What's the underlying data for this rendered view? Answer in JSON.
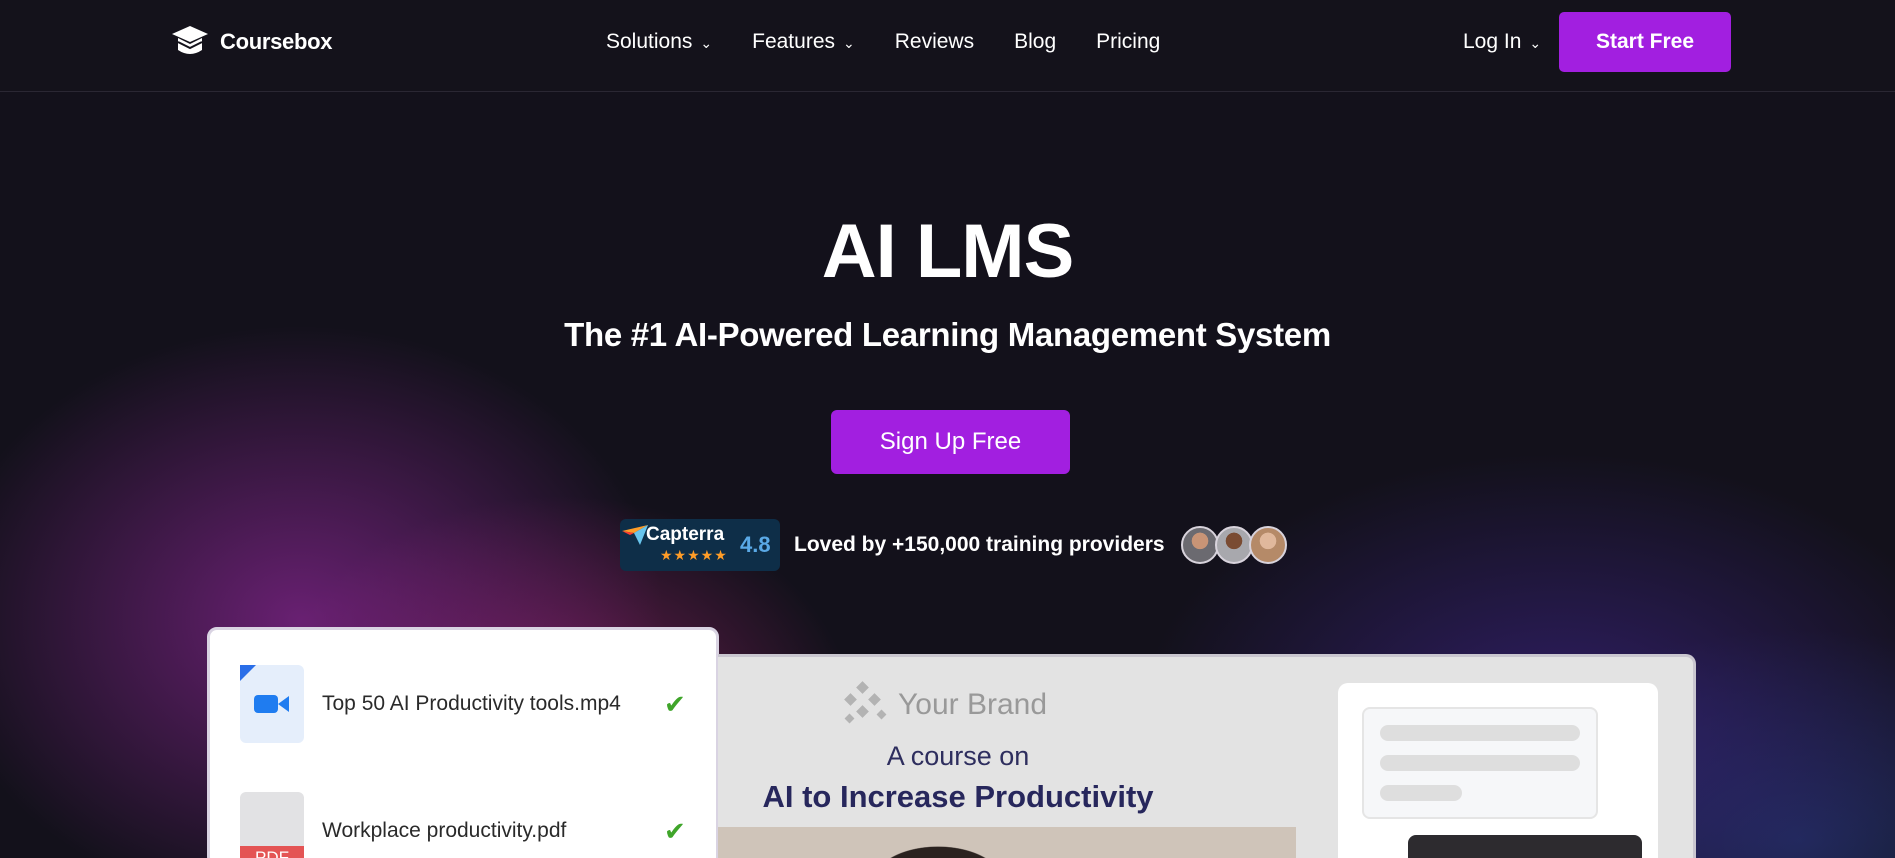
{
  "header": {
    "logo_text": "Coursebox",
    "nav": [
      {
        "label": "Solutions",
        "has_dropdown": true
      },
      {
        "label": "Features",
        "has_dropdown": true
      },
      {
        "label": "Reviews",
        "has_dropdown": false
      },
      {
        "label": "Blog",
        "has_dropdown": false
      },
      {
        "label": "Pricing",
        "has_dropdown": false
      }
    ],
    "login_label": "Log In",
    "start_label": "Start Free"
  },
  "hero": {
    "title": "AI LMS",
    "subtitle": "The #1 AI-Powered Learning Management System",
    "cta_label": "Sign Up Free",
    "capterra": {
      "name": "Capterra",
      "score": "4.8",
      "stars": "★★★★★"
    },
    "loved_text": "Loved by +150,000 training providers"
  },
  "files": [
    {
      "name": "Top 50 AI Productivity tools.mp4",
      "icon": "video-file-icon",
      "status": "check-icon"
    },
    {
      "name": "Workplace productivity.pdf",
      "icon": "pdf-file-icon",
      "tag": "PDF",
      "status": "check-icon"
    }
  ],
  "preview": {
    "brand": "Your Brand",
    "course_on": "A course on",
    "course_title": "AI to Increase Productivity"
  },
  "colors": {
    "accent": "#a21fe0",
    "background": "#13111b",
    "check": "#3fa52a"
  }
}
